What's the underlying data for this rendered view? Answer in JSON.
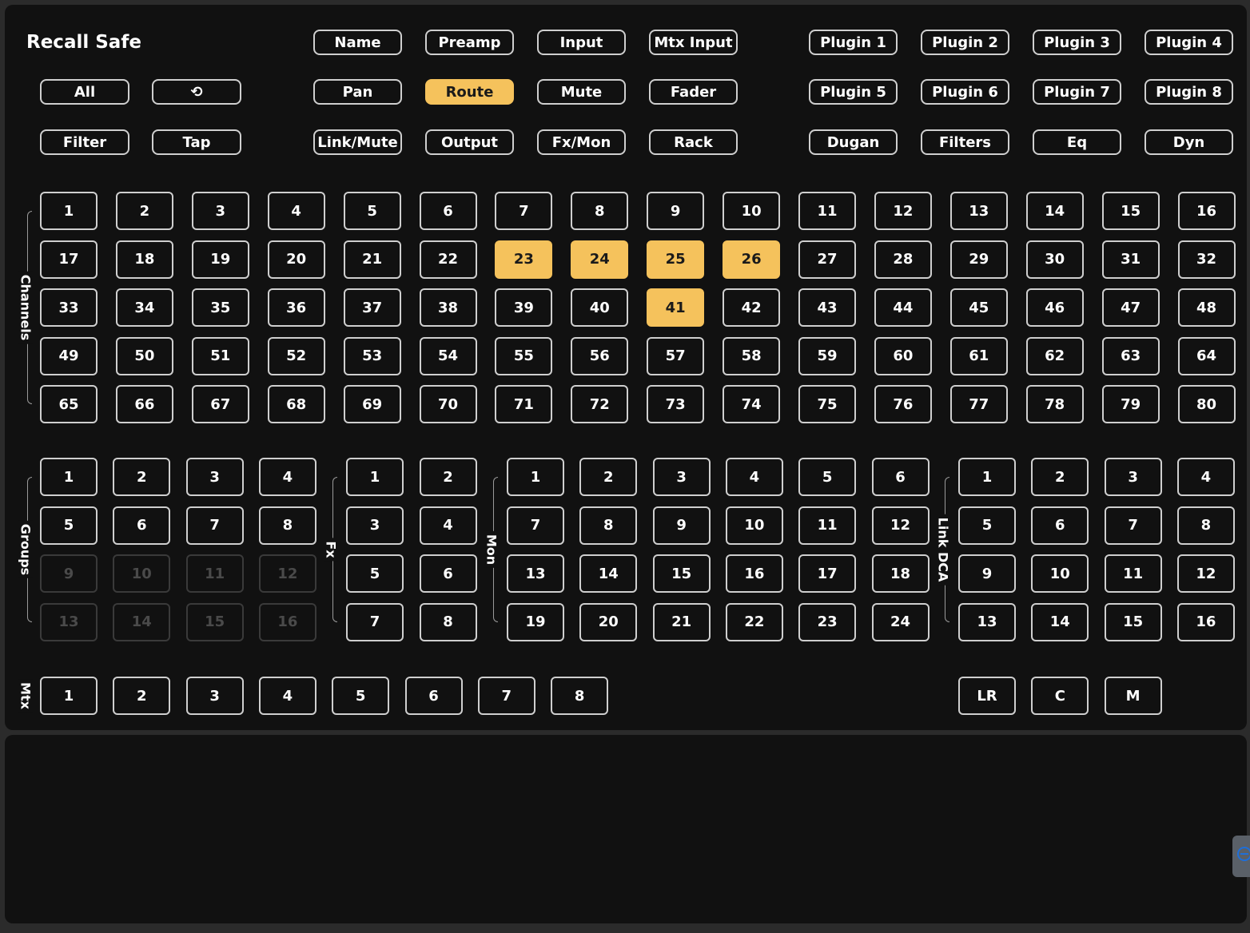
{
  "title": "Recall Safe",
  "categories": {
    "all": "All",
    "undo": "⟲",
    "filter": "Filter",
    "tap": "Tap",
    "name": "Name",
    "preamp": "Preamp",
    "input": "Input",
    "mtx_input": "Mtx Input",
    "pan": "Pan",
    "route": "Route",
    "mute": "Mute",
    "fader": "Fader",
    "link_mute": "Link/Mute",
    "output": "Output",
    "fx_mon": "Fx/Mon",
    "rack": "Rack",
    "plugin1": "Plugin 1",
    "plugin2": "Plugin 2",
    "plugin3": "Plugin 3",
    "plugin4": "Plugin 4",
    "plugin5": "Plugin 5",
    "plugin6": "Plugin 6",
    "plugin7": "Plugin 7",
    "plugin8": "Plugin 8",
    "dugan": "Dugan",
    "filters": "Filters",
    "eq": "Eq",
    "dyn": "Dyn"
  },
  "active_category": "route",
  "sections": {
    "channels": {
      "label": "Channels",
      "count": 80,
      "active": [
        23,
        24,
        25,
        26,
        41
      ],
      "disabled": []
    },
    "groups": {
      "label": "Groups",
      "count": 16,
      "active": [],
      "disabled": [
        9,
        10,
        11,
        12,
        13,
        14,
        15,
        16
      ]
    },
    "fx": {
      "label": "Fx",
      "count": 8,
      "active": [],
      "disabled": []
    },
    "mon": {
      "label": "Mon",
      "count": 24,
      "active": [],
      "disabled": []
    },
    "link_dca": {
      "label": "Link DCA",
      "count": 16,
      "active": [],
      "disabled": []
    },
    "mtx": {
      "label": "Mtx",
      "count": 8,
      "active": [],
      "disabled": []
    }
  },
  "mains": [
    "LR",
    "C",
    "M"
  ]
}
